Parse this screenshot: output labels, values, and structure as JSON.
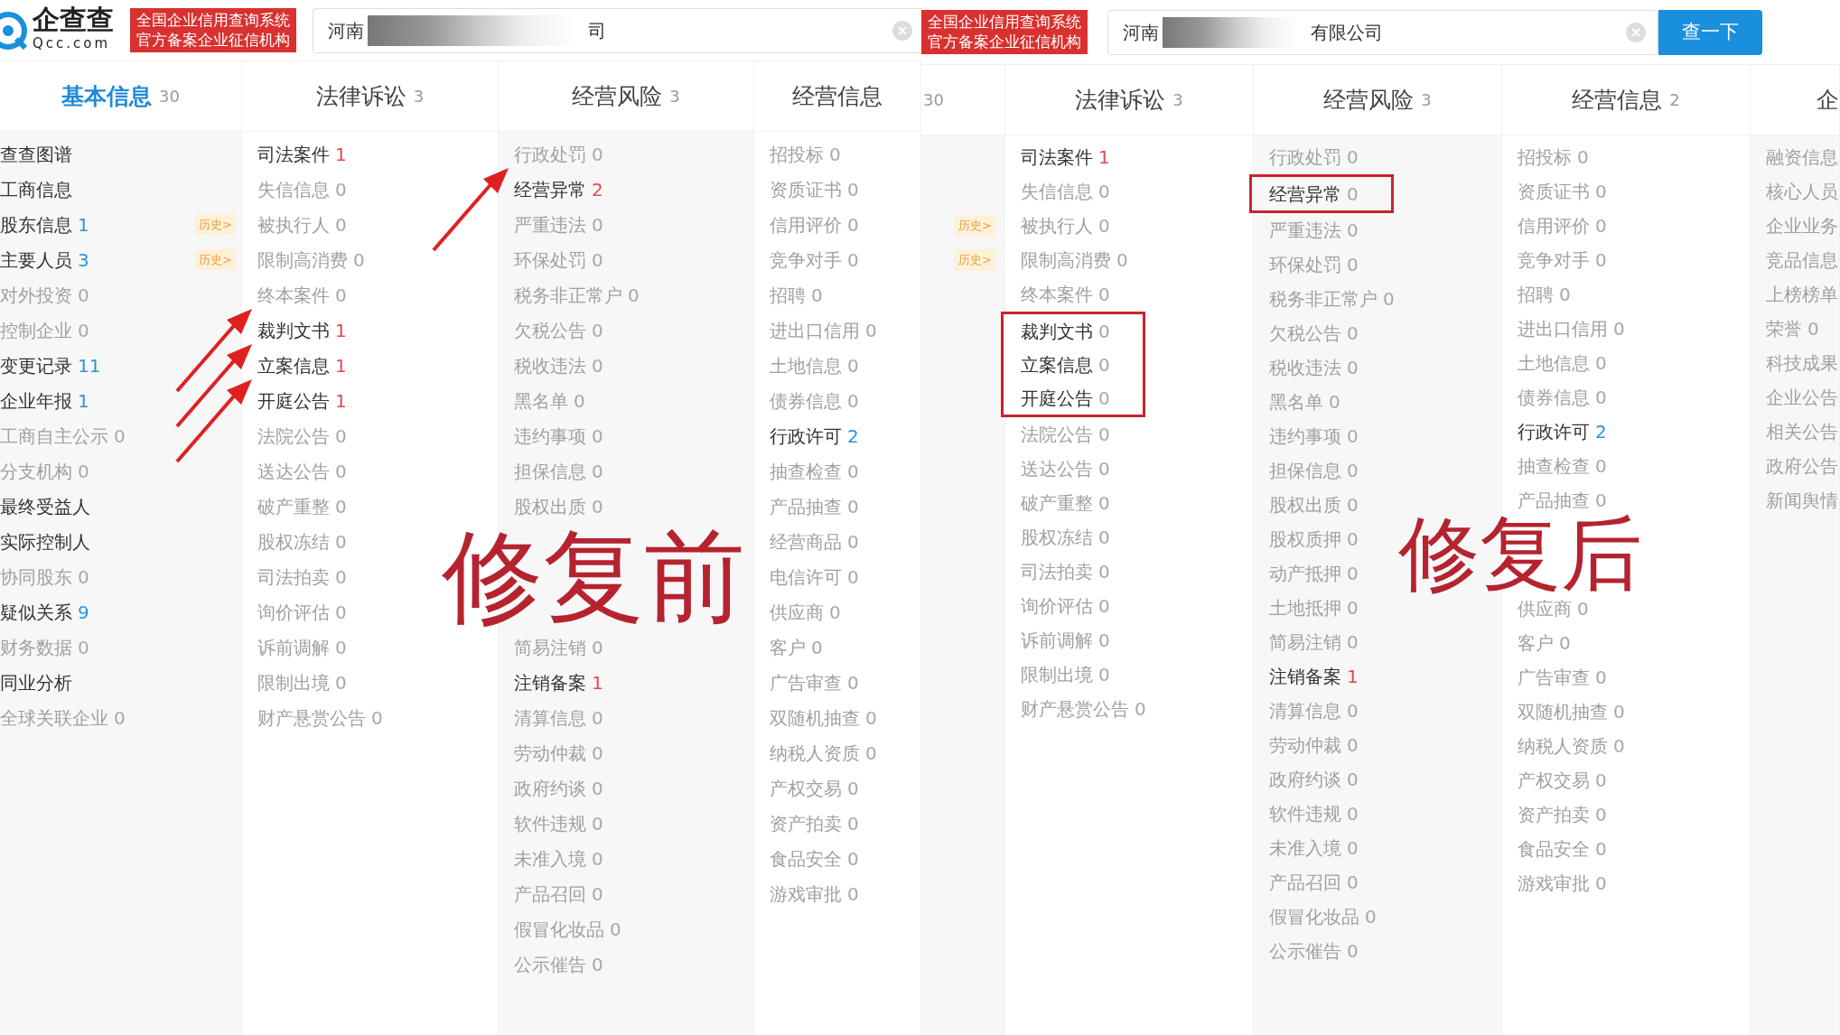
{
  "panels": [
    {
      "kind": "arrow",
      "header": {
        "logo": {
          "name": "企查查",
          "domain": "Qcc.com"
        },
        "badge": [
          "全国企业信用查询系统",
          "官方备案企业征信机构"
        ],
        "search": {
          "value_start": "河南",
          "value_end": "司"
        }
      },
      "columns": [
        {
          "title": "基本信息",
          "count": "30",
          "selected": true,
          "items": [
            {
              "label": "查查图谱",
              "active": true,
              "highlighted": false
            },
            {
              "label": "工商信息",
              "active": true,
              "highlighted": false
            },
            {
              "label": "股东信息",
              "count": "1",
              "color": "#2a96d8",
              "active": true,
              "highlighted": false,
              "tag": "历史>"
            },
            {
              "label": "主要人员",
              "count": "3",
              "color": "#2a96d8",
              "active": true,
              "highlighted": false,
              "tag": "历史>"
            },
            {
              "label": "对外投资",
              "count": "0",
              "active": false,
              "highlighted": false
            },
            {
              "label": "控制企业",
              "count": "0",
              "active": false,
              "highlighted": false
            },
            {
              "label": "变更记录",
              "count": "11",
              "color": "#2a96d8",
              "active": true,
              "highlighted": false
            },
            {
              "label": "企业年报",
              "count": "1",
              "color": "#2a96d8",
              "active": true,
              "highlighted": false
            },
            {
              "label": "工商自主公示",
              "count": "0",
              "active": false,
              "highlighted": false
            },
            {
              "label": "分支机构",
              "count": "0",
              "active": false,
              "highlighted": false
            },
            {
              "label": "最终受益人",
              "active": true,
              "highlighted": false
            },
            {
              "label": "实际控制人",
              "active": true,
              "highlighted": false
            },
            {
              "label": "协同股东",
              "count": "0",
              "active": false,
              "highlighted": false
            },
            {
              "label": "疑似关系",
              "count": "9",
              "color": "#2a96d8",
              "active": true,
              "highlighted": false
            },
            {
              "label": "财务数据",
              "count": "0",
              "active": false,
              "highlighted": false
            },
            {
              "label": "同业分析",
              "active": true,
              "highlighted": false
            },
            {
              "label": "全球关联企业",
              "count": "0",
              "active": false,
              "highlighted": false
            }
          ]
        },
        {
          "title": "法律诉讼",
          "count": "3",
          "selected": false,
          "items": [
            {
              "label": "司法案件",
              "count": "1",
              "color": "#e5484d",
              "active": true,
              "highlighted": false
            },
            {
              "label": "失信信息",
              "count": "0",
              "active": false,
              "highlighted": false
            },
            {
              "label": "被执行人",
              "count": "0",
              "active": false,
              "highlighted": false
            },
            {
              "label": "限制高消费",
              "count": "0",
              "active": false,
              "highlighted": false
            },
            {
              "label": "终本案件",
              "count": "0",
              "active": false,
              "highlighted": false
            },
            {
              "label": "裁判文书",
              "count": "1",
              "color": "#e5484d",
              "active": true,
              "highlighted": true
            },
            {
              "label": "立案信息",
              "count": "1",
              "color": "#e5484d",
              "active": true,
              "highlighted": true
            },
            {
              "label": "开庭公告",
              "count": "1",
              "color": "#e5484d",
              "active": true,
              "highlighted": true
            },
            {
              "label": "法院公告",
              "count": "0",
              "active": false,
              "highlighted": false
            },
            {
              "label": "送达公告",
              "count": "0",
              "active": false,
              "highlighted": false
            },
            {
              "label": "破产重整",
              "count": "0",
              "active": false,
              "highlighted": false
            },
            {
              "label": "股权冻结",
              "count": "0",
              "active": false,
              "highlighted": false
            },
            {
              "label": "司法拍卖",
              "count": "0",
              "active": false,
              "highlighted": false
            },
            {
              "label": "询价评估",
              "count": "0",
              "active": false,
              "highlighted": false
            },
            {
              "label": "诉前调解",
              "count": "0",
              "active": false,
              "highlighted": false
            },
            {
              "label": "限制出境",
              "count": "0",
              "active": false,
              "highlighted": false
            },
            {
              "label": "财产悬赏公告",
              "count": "0",
              "active": false,
              "highlighted": false
            }
          ]
        },
        {
          "title": "经营风险",
          "count": "3",
          "selected": false,
          "items": [
            {
              "label": "行政处罚",
              "count": "0",
              "active": false,
              "highlighted": false
            },
            {
              "label": "经营异常",
              "count": "2",
              "color": "#e5484d",
              "active": true,
              "highlighted": true
            },
            {
              "label": "严重违法",
              "count": "0",
              "active": false,
              "highlighted": false
            },
            {
              "label": "环保处罚",
              "count": "0",
              "active": false,
              "highlighted": false
            },
            {
              "label": "税务非正常户",
              "count": "0",
              "active": false,
              "highlighted": false
            },
            {
              "label": "欠税公告",
              "count": "0",
              "active": false,
              "highlighted": false
            },
            {
              "label": "税收违法",
              "count": "0",
              "active": false,
              "highlighted": false
            },
            {
              "label": "黑名单",
              "count": "0",
              "active": false,
              "highlighted": false
            },
            {
              "label": "违约事项",
              "count": "0",
              "active": false,
              "highlighted": false
            },
            {
              "label": "担保信息",
              "count": "0",
              "active": false,
              "highlighted": false
            },
            {
              "label": "股权出质",
              "count": "0",
              "active": false,
              "highlighted": false
            }
          ],
          "caption": "修复前",
          "items_below": [
            {
              "label": "简易注销",
              "count": "0",
              "active": false,
              "highlighted": false
            },
            {
              "label": "注销备案",
              "count": "1",
              "color": "#e5484d",
              "active": true,
              "highlighted": false
            },
            {
              "label": "清算信息",
              "count": "0",
              "active": false,
              "highlighted": false
            },
            {
              "label": "劳动仲裁",
              "count": "0",
              "active": false,
              "highlighted": false
            },
            {
              "label": "政府约谈",
              "count": "0",
              "active": false,
              "highlighted": false
            },
            {
              "label": "软件违规",
              "count": "0",
              "active": false,
              "highlighted": false
            },
            {
              "label": "未准入境",
              "count": "0",
              "active": false,
              "highlighted": false
            },
            {
              "label": "产品召回",
              "count": "0",
              "active": false,
              "highlighted": false
            },
            {
              "label": "假冒化妆品",
              "count": "0",
              "active": false,
              "highlighted": false
            },
            {
              "label": "公示催告",
              "count": "0",
              "active": false,
              "highlighted": false
            }
          ]
        },
        {
          "title": "经营信息",
          "selected": false,
          "items": [
            {
              "label": "招投标",
              "count": "0",
              "active": false,
              "highlighted": false
            },
            {
              "label": "资质证书",
              "count": "0",
              "active": false,
              "highlighted": false
            },
            {
              "label": "信用评价",
              "count": "0",
              "active": false,
              "highlighted": false
            },
            {
              "label": "竞争对手",
              "count": "0",
              "active": false,
              "highlighted": false
            },
            {
              "label": "招聘",
              "count": "0",
              "active": false,
              "highlighted": false
            },
            {
              "label": "进出口信用",
              "count": "0",
              "active": false,
              "highlighted": false
            },
            {
              "label": "土地信息",
              "count": "0",
              "active": false,
              "highlighted": false
            },
            {
              "label": "债券信息",
              "count": "0",
              "active": false,
              "highlighted": false
            },
            {
              "label": "行政许可",
              "count": "2",
              "color": "#2a96d8",
              "active": true,
              "highlighted": false
            },
            {
              "label": "抽查检查",
              "count": "0",
              "active": false,
              "highlighted": false
            },
            {
              "label": "产品抽查",
              "count": "0",
              "active": false,
              "highlighted": false
            },
            {
              "label": "经营商品",
              "count": "0",
              "active": false,
              "highlighted": false
            },
            {
              "label": "电信许可",
              "count": "0",
              "active": false,
              "highlighted": false
            },
            {
              "label": "供应商",
              "count": "0",
              "active": false,
              "highlighted": false
            },
            {
              "label": "客户",
              "count": "0",
              "active": false,
              "highlighted": false
            },
            {
              "label": "广告审查",
              "count": "0",
              "active": false,
              "highlighted": false
            },
            {
              "label": "双随机抽查",
              "count": "0",
              "active": false,
              "highlighted": false
            },
            {
              "label": "纳税人资质",
              "count": "0",
              "active": false,
              "highlighted": false
            },
            {
              "label": "产权交易",
              "count": "0",
              "active": false,
              "highlighted": false
            },
            {
              "label": "资产拍卖",
              "count": "0",
              "active": false,
              "highlighted": false
            },
            {
              "label": "食品安全",
              "count": "0",
              "active": false,
              "highlighted": false
            },
            {
              "label": "游戏审批",
              "count": "0",
              "active": false,
              "highlighted": false
            }
          ]
        }
      ]
    },
    {
      "kind": "frame",
      "header": {
        "badge": [
          "全国企业信用查询系统",
          "官方备案企业征信机构"
        ],
        "search": {
          "value_start": "河南",
          "value_end": "有限公司"
        },
        "button": "查一下"
      },
      "columns": [
        {
          "count": "30",
          "history_tags": [
            "历史>",
            "历史>"
          ]
        },
        {
          "title": "法律诉讼",
          "count": "3",
          "selected": false,
          "items": [
            {
              "label": "司法案件",
              "count": "1",
              "color": "#e5484d",
              "active": true,
              "highlighted": false
            },
            {
              "label": "失信信息",
              "count": "0",
              "active": false,
              "highlighted": false
            },
            {
              "label": "被执行人",
              "count": "0",
              "active": false,
              "highlighted": false
            },
            {
              "label": "限制高消费",
              "count": "0",
              "active": false,
              "highlighted": false
            },
            {
              "label": "终本案件",
              "count": "0",
              "active": false,
              "highlighted": false
            },
            {
              "label": "裁判文书",
              "count": "0",
              "active": true,
              "highlighted": true
            },
            {
              "label": "立案信息",
              "count": "0",
              "active": true,
              "highlighted": true
            },
            {
              "label": "开庭公告",
              "count": "0",
              "active": true,
              "highlighted": true
            },
            {
              "label": "法院公告",
              "count": "0",
              "active": false,
              "highlighted": false
            },
            {
              "label": "送达公告",
              "count": "0",
              "active": false,
              "highlighted": false
            },
            {
              "label": "破产重整",
              "count": "0",
              "active": false,
              "highlighted": false
            },
            {
              "label": "股权冻结",
              "count": "0",
              "active": false,
              "highlighted": false
            },
            {
              "label": "司法拍卖",
              "count": "0",
              "active": false,
              "highlighted": false
            },
            {
              "label": "询价评估",
              "count": "0",
              "active": false,
              "highlighted": false
            },
            {
              "label": "诉前调解",
              "count": "0",
              "active": false,
              "highlighted": false
            },
            {
              "label": "限制出境",
              "count": "0",
              "active": false,
              "highlighted": false
            },
            {
              "label": "财产悬赏公告",
              "count": "0",
              "active": false,
              "highlighted": false
            }
          ]
        },
        {
          "title": "经营风险",
          "count": "3",
          "selected": false,
          "items": [
            {
              "label": "行政处罚",
              "count": "0",
              "active": false,
              "highlighted": false
            },
            {
              "label": "经营异常",
              "count": "0",
              "active": true,
              "highlighted": true
            },
            {
              "label": "严重违法",
              "count": "0",
              "active": false,
              "highlighted": false
            },
            {
              "label": "环保处罚",
              "count": "0",
              "active": false,
              "highlighted": false
            },
            {
              "label": "税务非正常户",
              "count": "0",
              "active": false,
              "highlighted": false
            },
            {
              "label": "欠税公告",
              "count": "0",
              "active": false,
              "highlighted": false
            },
            {
              "label": "税收违法",
              "count": "0",
              "active": false,
              "highlighted": false
            },
            {
              "label": "黑名单",
              "count": "0",
              "active": false,
              "highlighted": false
            },
            {
              "label": "违约事项",
              "count": "0",
              "active": false,
              "highlighted": false
            },
            {
              "label": "担保信息",
              "count": "0",
              "active": false,
              "highlighted": false
            },
            {
              "label": "股权出质",
              "count": "0",
              "active": false,
              "highlighted": false
            },
            {
              "label": "股权质押",
              "count": "0",
              "active": false,
              "highlighted": false
            },
            {
              "label": "动产抵押",
              "count": "0",
              "active": false,
              "highlighted": false
            },
            {
              "label": "土地抵押",
              "count": "0",
              "active": false,
              "highlighted": false
            },
            {
              "label": "简易注销",
              "count": "0",
              "active": false,
              "highlighted": false
            },
            {
              "label": "注销备案",
              "count": "1",
              "color": "#e5484d",
              "active": true,
              "highlighted": false
            },
            {
              "label": "清算信息",
              "count": "0",
              "active": false,
              "highlighted": false
            },
            {
              "label": "劳动仲裁",
              "count": "0",
              "active": false,
              "highlighted": false
            },
            {
              "label": "政府约谈",
              "count": "0",
              "active": false,
              "highlighted": false
            },
            {
              "label": "软件违规",
              "count": "0",
              "active": false,
              "highlighted": false
            },
            {
              "label": "未准入境",
              "count": "0",
              "active": false,
              "highlighted": false
            },
            {
              "label": "产品召回",
              "count": "0",
              "active": false,
              "highlighted": false
            },
            {
              "label": "假冒化妆品",
              "count": "0",
              "active": false,
              "highlighted": false
            },
            {
              "label": "公示催告",
              "count": "0",
              "active": false,
              "highlighted": false
            }
          ]
        },
        {
          "title": "经营信息",
          "count": "2",
          "selected": false,
          "items": [
            {
              "label": "招投标",
              "count": "0",
              "active": false,
              "highlighted": false
            },
            {
              "label": "资质证书",
              "count": "0",
              "active": false,
              "highlighted": false
            },
            {
              "label": "信用评价",
              "count": "0",
              "active": false,
              "highlighted": false
            },
            {
              "label": "竞争对手",
              "count": "0",
              "active": false,
              "highlighted": false
            },
            {
              "label": "招聘",
              "count": "0",
              "active": false,
              "highlighted": false
            },
            {
              "label": "进出口信用",
              "count": "0",
              "active": false,
              "highlighted": false
            },
            {
              "label": "土地信息",
              "count": "0",
              "active": false,
              "highlighted": false
            },
            {
              "label": "债券信息",
              "count": "0",
              "active": false,
              "highlighted": false
            },
            {
              "label": "行政许可",
              "count": "2",
              "color": "#2a96d8",
              "active": true,
              "highlighted": false
            },
            {
              "label": "抽查检查",
              "count": "0",
              "active": false,
              "highlighted": false
            },
            {
              "label": "产品抽查",
              "count": "0",
              "active": false,
              "highlighted": false
            }
          ],
          "caption": "修复后",
          "items_below": [
            {
              "label": "供应商",
              "count": "0",
              "active": false,
              "highlighted": false
            },
            {
              "label": "客户",
              "count": "0",
              "active": false,
              "highlighted": false
            },
            {
              "label": "广告审查",
              "count": "0",
              "active": false,
              "highlighted": false
            },
            {
              "label": "双随机抽查",
              "count": "0",
              "active": false,
              "highlighted": false
            },
            {
              "label": "纳税人资质",
              "count": "0",
              "active": false,
              "highlighted": false
            },
            {
              "label": "产权交易",
              "count": "0",
              "active": false,
              "highlighted": false
            },
            {
              "label": "资产拍卖",
              "count": "0",
              "active": false,
              "highlighted": false
            },
            {
              "label": "食品安全",
              "count": "0",
              "active": false,
              "highlighted": false
            },
            {
              "label": "游戏审批",
              "count": "0",
              "active": false,
              "highlighted": false
            }
          ]
        },
        {
          "title": "企",
          "selected": false,
          "items": [
            {
              "label": "融资信息",
              "active": false,
              "highlighted": false
            },
            {
              "label": "核心人员",
              "active": false,
              "highlighted": false
            },
            {
              "label": "企业业务",
              "active": false,
              "highlighted": false
            },
            {
              "label": "竞品信息",
              "active": false,
              "highlighted": false
            },
            {
              "label": "上榜榜单",
              "active": false,
              "highlighted": false
            },
            {
              "label": "荣誉",
              "count": "0",
              "active": false,
              "highlighted": false
            },
            {
              "label": "科技成果",
              "active": false,
              "highlighted": false
            },
            {
              "label": "企业公告",
              "active": false,
              "highlighted": false
            },
            {
              "label": "相关公告",
              "active": false,
              "highlighted": false
            },
            {
              "label": "政府公告",
              "active": false,
              "highlighted": false
            },
            {
              "label": "新闻舆情",
              "active": false,
              "highlighted": false
            }
          ]
        }
      ]
    }
  ]
}
